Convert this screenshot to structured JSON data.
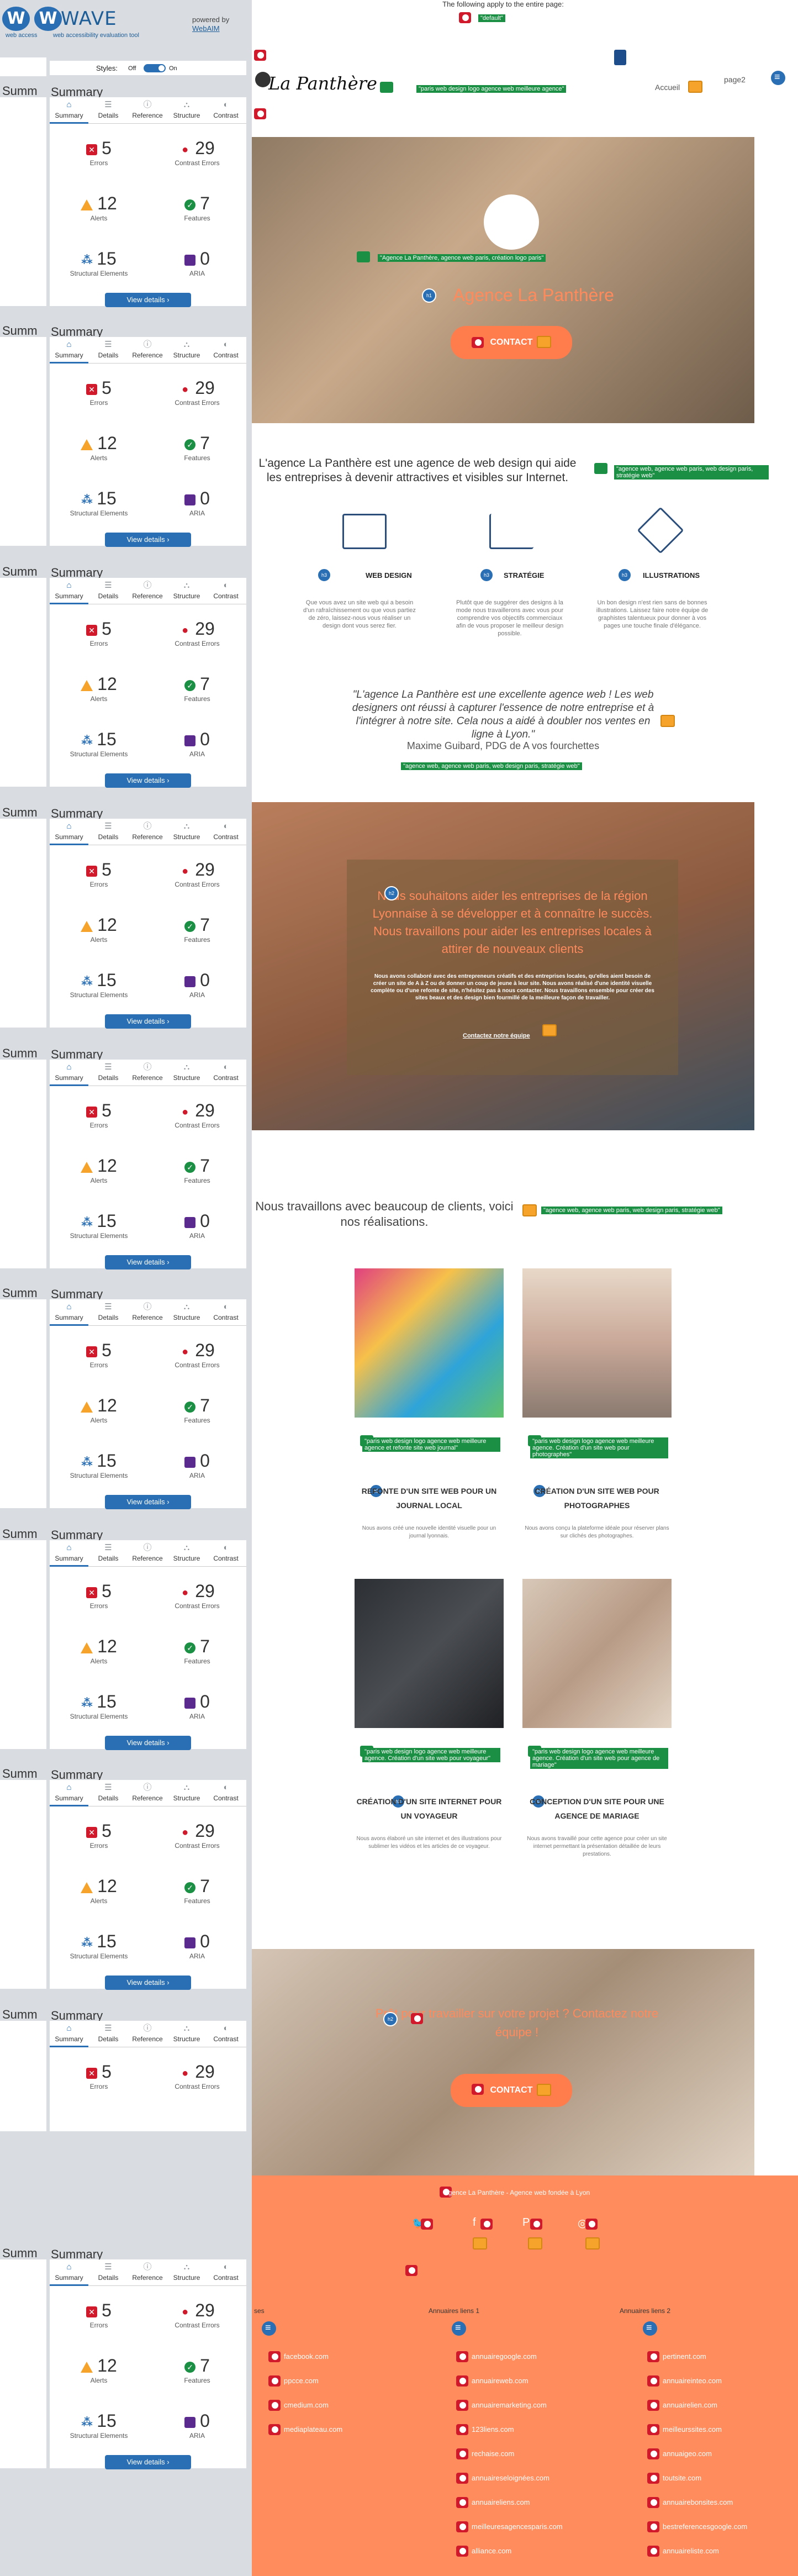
{
  "wave": {
    "logo_letter": "W",
    "logo_text": "WAVE",
    "logo_sub": "web accessibility evaluation tool",
    "logo_sub_short": "web access",
    "powered_by": "powered by",
    "webaim": "WebAIM",
    "styles_label": "Styles:",
    "toggle_off": "Off",
    "toggle_on": "On",
    "panel_title": "Summary",
    "panel_title_short": "Summ",
    "tabs": [
      "Summary",
      "Details",
      "Reference",
      "Structure",
      "Contrast"
    ],
    "stats": {
      "errors": {
        "value": "5",
        "label": "Errors"
      },
      "contrast": {
        "value": "29",
        "label": "Contrast Errors"
      },
      "alerts": {
        "value": "12",
        "label": "Alerts"
      },
      "features": {
        "value": "7",
        "label": "Features"
      },
      "structural": {
        "value": "15",
        "label": "Structural Elements"
      },
      "aria": {
        "value": "0",
        "label": "ARIA"
      }
    },
    "view_details": "View details ›",
    "colors": {
      "primary": "#2a6fb3",
      "error": "#d0192b",
      "alert": "#f5a32a",
      "feature": "#1b8f44",
      "aria": "#5b2a8e"
    }
  },
  "page": {
    "top_note": "The following apply to the entire page:",
    "top_note_alt": "\"default\"",
    "logo_text": "La Panthère",
    "logo_alt": "\"paris web design logo agence web meilleure agence\"",
    "nav_home": "Accueil",
    "nav_page2": "page2",
    "hero_logo_alt": "\"Agence La Panthère, agence web paris, création logo paris\"",
    "hero_title": "Agence La Panthère",
    "hero_button": "CONTACT",
    "intro_text": "L'agence La Panthère est une agence de web design qui aide les entreprises à devenir attractives et visibles sur Internet.",
    "intro_alt": "\"agence web, agence web paris, web design paris, stratégie web\"",
    "features": [
      {
        "title": "WEB DESIGN",
        "desc": "Que vous avez un site web qui a besoin d'un rafraîchissement ou que vous partiez de zéro, laissez-nous vous réaliser un design dont vous serez fier."
      },
      {
        "title": "STRATÉGIE",
        "desc": "Plutôt que de suggérer des designs à la mode nous travaillerons avec vous pour comprendre vos objectifs commerciaux afin de vous proposer le meilleur design possible."
      },
      {
        "title": "ILLUSTRATIONS",
        "desc": "Un bon design n'est rien sans de bonnes illustrations. Laissez faire notre équipe de graphistes talentueux pour donner à vos pages une touche finale d'élégance."
      }
    ],
    "quote": "\"L'agence La Panthère est une excellente agence web ! Les web designers ont réussi à capturer l'essence de notre entreprise et à l'intégrer à notre site. Cela nous a aidé à doubler nos ventes en ligne à Lyon.\"",
    "quote_author": "Maxime Guibard, PDG de A vos fourchettes",
    "quote_alt": "\"agence web, agence web paris, web design paris, stratégie web\"",
    "band2_title": "Nous souhaitons aider les entreprises de la région Lyonnaise à se développer et à connaître le succès. Nous travaillons pour aider les entreprises locales à attirer de nouveaux clients",
    "band2_text": "Nous avons collaboré avec des entrepreneurs créatifs et des entreprises locales, qu'elles aient besoin de créer un site de A à Z ou de donner un coup de jeune à leur site. Nous avons réalisé d'une identité visuelle complète ou d'une refonte de site, n'hésitez pas à nous contacter. Nous travaillons ensemble pour créer des sites beaux et des design bien fourmillé de la meilleure façon de travailler.",
    "band2_link": "Contactez notre équipe",
    "clients_title": "Nous travaillons avec beaucoup de clients, voici nos réalisations.",
    "clients_alt": "\"agence web, agence web paris, web design paris, stratégie web\"",
    "cards": [
      {
        "alt": "\"paris web design logo agence web meilleure agence et refonte site web journal\"",
        "title": "REFONTE D'UN SITE WEB POUR UN JOURNAL LOCAL",
        "desc": "Nous avons créé une nouvelle identité visuelle pour un journal lyonnais."
      },
      {
        "alt": "\"paris web design logo agence web meilleure agence. Création d'un site web pour photographes\"",
        "title": "CRÉATION D'UN SITE WEB POUR PHOTOGRAPHES",
        "desc": "Nous avons conçu la plateforme idéale pour réserver plans sur clichés des photographes."
      },
      {
        "alt": "\"paris web design logo agence web meilleure agence. Création d'un site web pour voyageur\"",
        "title": "CRÉATION D'UN SITE INTERNET POUR UN VOYAGEUR",
        "desc": "Nous avons élaboré un site internet et des illustrations pour sublimer les vidéos et les articles de ce voyageur."
      },
      {
        "alt": "\"paris web design logo agence web meilleure agence. Création d'un site web pour agence de mariage\"",
        "title": "CONCEPTION D'UN SITE POUR UNE AGENCE DE MARIAGE",
        "desc": "Nous avons travaillé pour cette agence pour créer un site internet permettant la présentation détaillée de leurs prestations."
      }
    ],
    "band3_title": "Prêt pour travailler sur votre projet ? Contactez notre équipe !",
    "band3_button": "CONTACT",
    "footer_top": "Agence La Panthère - Agence web fondée à Lyon",
    "footer_cols": [
      {
        "title": "ses",
        "links": [
          "facebook.com",
          "ppcce.com",
          "cmedium.com",
          "mediaplateau.com"
        ]
      },
      {
        "title": "Annuaires liens 1",
        "links": [
          "annuairegoogle.com",
          "annuaireweb.com",
          "annuairemarketing.com",
          "123liens.com",
          "rechaise.com",
          "annuaireseloignées.com",
          "annuaireliens.com",
          "meilleuresagencesparis.com",
          "alliance.com"
        ]
      },
      {
        "title": "Annuaires liens 2",
        "links": [
          "pertinent.com",
          "annuaireinteo.com",
          "annuairelien.com",
          "meilleurssites.com",
          "annuaigeo.com",
          "toutsite.com",
          "annuairebonsites.com",
          "bestreferencesgoogle.com",
          "annuaireliste.com"
        ]
      }
    ]
  }
}
